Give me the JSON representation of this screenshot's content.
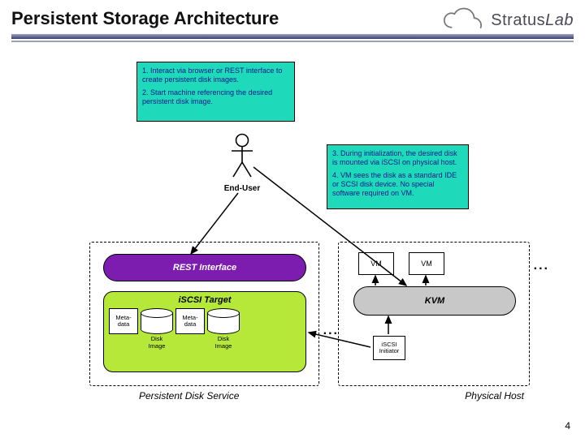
{
  "title": "Persistent Storage Architecture",
  "brand": {
    "name": "Stratus",
    "suffix": "Lab"
  },
  "page_number": "4",
  "notes": {
    "steps_a_1": "1. Interact via browser or REST interface to create persistent disk images.",
    "steps_a_2": "2. Start machine referencing the desired persistent disk image.",
    "steps_b_1": "3. During initialization, the desired disk is mounted via iSCSI on physical host.",
    "steps_b_2": "4. VM sees the disk as a standard IDE or SCSI disk device. No special software required on VM."
  },
  "actors": {
    "end_user": "End-User"
  },
  "groups": {
    "pds": "Persistent Disk Service",
    "phost": "Physical Host"
  },
  "components": {
    "rest": "REST Interface",
    "iscsi_target": "iSCSI Target",
    "metadata": "Meta-\ndata",
    "disk_image": "Disk\nImage",
    "vm": "VM",
    "kvm": "KVM",
    "iscsi_initiator": "iSCSI\nInitiator"
  },
  "ellipsis": "..."
}
